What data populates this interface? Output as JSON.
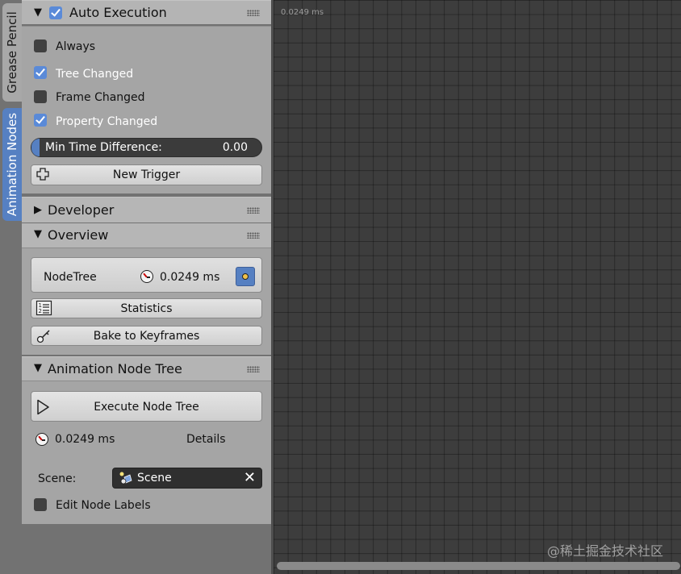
{
  "tabs": [
    {
      "label": "Grease Pencil",
      "active": false
    },
    {
      "label": "Animation Nodes",
      "active": true
    }
  ],
  "auto_execution": {
    "title": "Auto Execution",
    "enabled": true,
    "options": [
      {
        "label": "Always",
        "checked": false
      },
      {
        "label": "Tree Changed",
        "checked": true
      },
      {
        "label": "Frame Changed",
        "checked": false
      },
      {
        "label": "Property Changed",
        "checked": true
      }
    ],
    "min_time": {
      "label": "Min Time Difference:",
      "value": "0.00"
    },
    "new_trigger": "New Trigger"
  },
  "developer": {
    "title": "Developer"
  },
  "overview": {
    "title": "Overview",
    "tree_name": "NodeTree",
    "time": "0.0249 ms",
    "statistics": "Statistics",
    "bake": "Bake to Keyframes"
  },
  "node_tree_panel": {
    "title": "Animation Node Tree",
    "execute": "Execute Node Tree",
    "time": "0.0249 ms",
    "details": "Details",
    "scene_label": "Scene:",
    "scene_value": "Scene",
    "edit_labels": "Edit Node Labels",
    "edit_labels_checked": false
  },
  "editor": {
    "timing": "0.0249 ms",
    "watermark": "@稀土掘金技术社区"
  },
  "colors": {
    "accent": "#5680c2",
    "panel": "#a5a5a5",
    "header": "#b4b4b4",
    "editor_bg": "#3d3d3d"
  }
}
